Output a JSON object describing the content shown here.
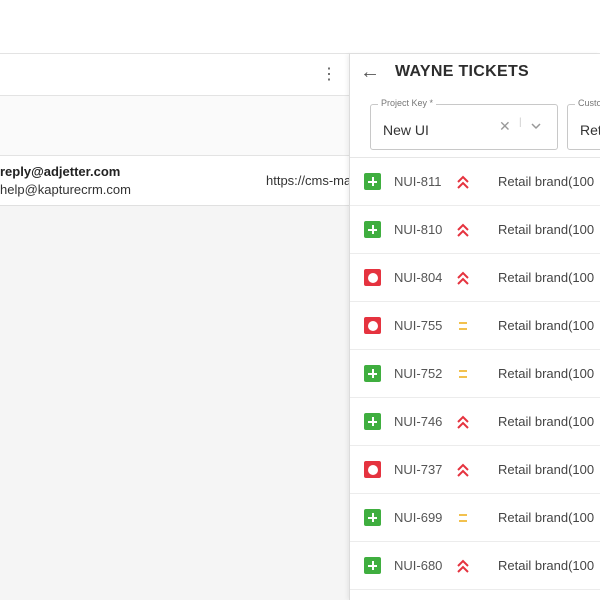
{
  "left_pane": {
    "mail_row": {
      "from": "reply@adjetter.com",
      "to": "help@kapturecrm.com",
      "url": "https://cms-ma"
    }
  },
  "panel": {
    "title": "WAYNE TICKETS",
    "filters": {
      "project_key_label": "Project Key *",
      "project_key_value": "New UI",
      "second_label": "Custo",
      "second_value": "Ret"
    }
  },
  "tickets": [
    {
      "type": "story",
      "key": "NUI-811",
      "priority": "high",
      "summary": "Retail brand(100"
    },
    {
      "type": "story",
      "key": "NUI-810",
      "priority": "high",
      "summary": "Retail brand(100"
    },
    {
      "type": "bug",
      "key": "NUI-804",
      "priority": "high",
      "summary": "Retail brand(100"
    },
    {
      "type": "bug",
      "key": "NUI-755",
      "priority": "medium",
      "summary": "Retail brand(100"
    },
    {
      "type": "story",
      "key": "NUI-752",
      "priority": "medium",
      "summary": "Retail brand(100"
    },
    {
      "type": "story",
      "key": "NUI-746",
      "priority": "high",
      "summary": "Retail brand(100"
    },
    {
      "type": "bug",
      "key": "NUI-737",
      "priority": "high",
      "summary": "Retail brand(100"
    },
    {
      "type": "story",
      "key": "NUI-699",
      "priority": "medium",
      "summary": "Retail brand(100"
    },
    {
      "type": "story",
      "key": "NUI-680",
      "priority": "high",
      "summary": "Retail brand(100"
    }
  ],
  "colors": {
    "story": "#3fae3f",
    "bug": "#e5333f",
    "priority_high": "#e5333f",
    "priority_medium": "#f2c14e"
  },
  "icons": {
    "back": "arrow-left-icon",
    "menu": "kebab-menu-icon",
    "clear": "close-icon",
    "dropdown": "chevron-down-icon"
  }
}
